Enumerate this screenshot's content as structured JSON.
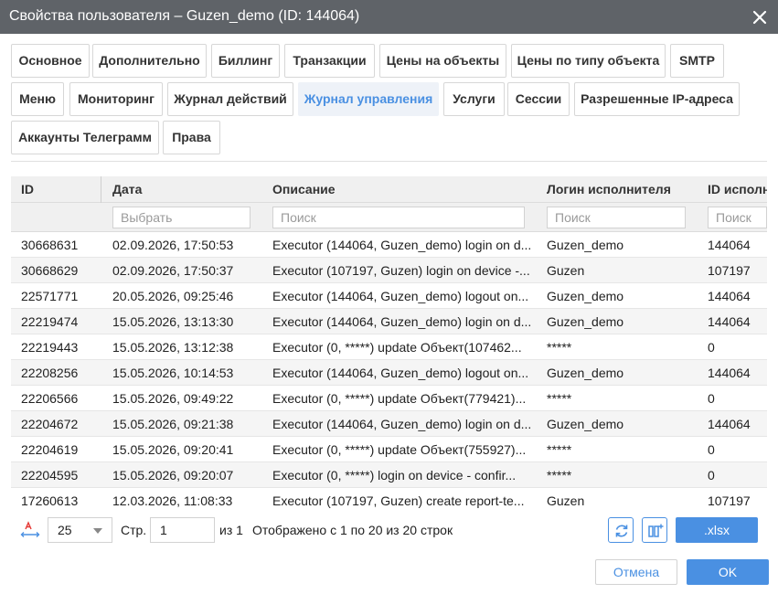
{
  "dialog": {
    "title": "Свойства пользователя – Guzen_demo (ID: 144064)"
  },
  "tabs": [
    {
      "label": "Основное"
    },
    {
      "label": "Дополнительно"
    },
    {
      "label": "Биллинг"
    },
    {
      "label": "Транзакции"
    },
    {
      "label": "Цены на объекты"
    },
    {
      "label": "Цены по типу объекта"
    },
    {
      "label": "SMTP"
    },
    {
      "label": "Меню"
    },
    {
      "label": "Мониторинг"
    },
    {
      "label": "Журнал действий"
    },
    {
      "label": "Журнал управления",
      "active": true
    },
    {
      "label": "Услуги"
    },
    {
      "label": "Сессии"
    },
    {
      "label": "Разрешенные IP-адреса"
    },
    {
      "label": "Аккаунты Телеграмм"
    },
    {
      "label": "Права"
    }
  ],
  "table": {
    "columns": [
      "ID",
      "Дата",
      "Описание",
      "Логин исполнителя",
      "ID исполни"
    ],
    "filters": [
      "Выбрать",
      "Поиск",
      "Поиск",
      "Поиск"
    ],
    "rows": [
      [
        "30668631",
        "02.09.2026, 17:50:53",
        "Executor (144064, Guzen_demo) login on d...",
        "Guzen_demo",
        "144064"
      ],
      [
        "30668629",
        "02.09.2026, 17:50:37",
        "Executor (107197, Guzen) login on device -...",
        "Guzen",
        "107197"
      ],
      [
        "22571771",
        "20.05.2026, 09:25:46",
        "Executor (144064, Guzen_demo) logout on...",
        "Guzen_demo",
        "144064"
      ],
      [
        "22219474",
        "15.05.2026, 13:13:30",
        "Executor (144064, Guzen_demo) login on d...",
        "Guzen_demo",
        "144064"
      ],
      [
        "22219443",
        "15.05.2026, 13:12:38",
        "Executor (0, *****) update Объект(107462...",
        "*****",
        "0"
      ],
      [
        "22208256",
        "15.05.2026, 10:14:53",
        "Executor (144064, Guzen_demo) logout on...",
        "Guzen_demo",
        "144064"
      ],
      [
        "22206566",
        "15.05.2026, 09:49:22",
        "Executor (0, *****) update Объект(779421)...",
        "*****",
        "0"
      ],
      [
        "22204672",
        "15.05.2026, 09:21:38",
        "Executor (144064, Guzen_demo) login on d...",
        "Guzen_demo",
        "144064"
      ],
      [
        "22204619",
        "15.05.2026, 09:20:41",
        "Executor (0, *****) update Объект(755927)...",
        "*****",
        "0"
      ],
      [
        "22204595",
        "15.05.2026, 09:20:07",
        "Executor (0, *****) login on device - confir...",
        "*****",
        "0"
      ],
      [
        "17260613",
        "12.03.2026, 11:08:33",
        "Executor (107197, Guzen) create report-te...",
        "Guzen",
        "107197"
      ]
    ]
  },
  "pager": {
    "page_size": "25",
    "page_label": "Стр.",
    "page_value": "1",
    "of_label": "из 1",
    "summary": "Отображено с 1 по 20 из 20 строк",
    "export_label": ".xlsx"
  },
  "actions": {
    "cancel_label": "Отмена",
    "ok_label": "OK"
  },
  "colors": {
    "accent": "#4a90e2",
    "titlebar": "#5f6368"
  }
}
